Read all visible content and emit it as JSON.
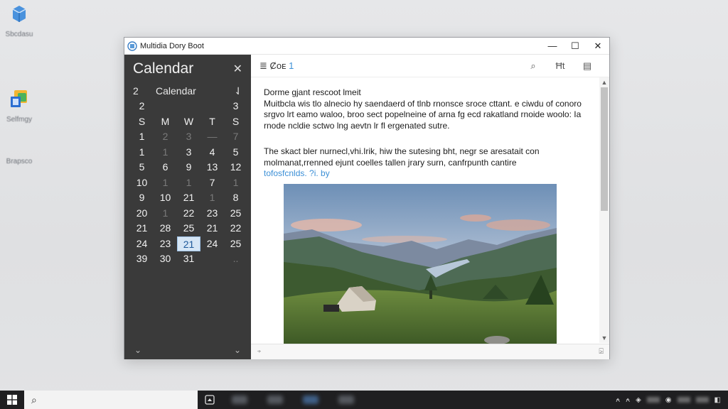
{
  "desktop": {
    "icons": [
      {
        "label": "Sbcdasu",
        "icon": "recycle-bin-icon",
        "color": "#3f86d6"
      },
      {
        "label": "Selfmgy",
        "icon": "folder-app-icon",
        "color": "#f2b531"
      },
      {
        "label": "Brapsco",
        "icon": "blank-icon",
        "color": "#d0d0d0"
      }
    ]
  },
  "window": {
    "title": "Multidia Dory Boot",
    "controls": {
      "minimize": "—",
      "maximize": "☐",
      "close": "✕"
    }
  },
  "sidebar": {
    "heading": "Calendar",
    "close": "✕",
    "month_row": {
      "left": "2",
      "label": "Calendar",
      "right": "⇃"
    },
    "rows": [
      [
        {
          "t": "2"
        },
        {
          "t": ""
        },
        {
          "t": ""
        },
        {
          "t": ""
        },
        {
          "t": "3"
        }
      ],
      [
        {
          "t": "S"
        },
        {
          "t": "M"
        },
        {
          "t": "W"
        },
        {
          "t": "T"
        },
        {
          "t": "S"
        }
      ],
      [
        {
          "t": "1"
        },
        {
          "t": "2",
          "dim": true
        },
        {
          "t": "3",
          "dim": true
        },
        {
          "t": "—",
          "dim": true
        },
        {
          "t": "7",
          "dim": true
        }
      ],
      [
        {
          "t": "1"
        },
        {
          "t": "1",
          "dim": true
        },
        {
          "t": "3"
        },
        {
          "t": "4"
        },
        {
          "t": "5"
        }
      ],
      [
        {
          "t": "5"
        },
        {
          "t": "6"
        },
        {
          "t": "9"
        },
        {
          "t": "13"
        },
        {
          "t": "12"
        }
      ],
      [
        {
          "t": "10"
        },
        {
          "t": "1",
          "dim": true
        },
        {
          "t": "1",
          "dim": true
        },
        {
          "t": "7"
        },
        {
          "t": "1",
          "dim": true
        }
      ],
      [
        {
          "t": "9"
        },
        {
          "t": "10"
        },
        {
          "t": "21"
        },
        {
          "t": "1",
          "dim": true
        },
        {
          "t": "8"
        }
      ],
      [
        {
          "t": "20"
        },
        {
          "t": "1",
          "dim": true
        },
        {
          "t": "22"
        },
        {
          "t": "23"
        },
        {
          "t": "25"
        }
      ],
      [
        {
          "t": "21"
        },
        {
          "t": "28"
        },
        {
          "t": "25"
        },
        {
          "t": "21"
        },
        {
          "t": "22"
        }
      ],
      [
        {
          "t": "24"
        },
        {
          "t": "23"
        },
        {
          "t": "21",
          "sel": true
        },
        {
          "t": "24"
        },
        {
          "t": "25"
        }
      ],
      [
        {
          "t": "39"
        },
        {
          "t": "30"
        },
        {
          "t": "31"
        },
        {
          "t": ""
        },
        {
          "t": "..",
          "dim": true
        }
      ]
    ],
    "footer_left": "⌄",
    "footer_right": "⌄"
  },
  "toolbar": {
    "label": "≣ Ȼoᴇ",
    "label_num": "1",
    "search_icon": "⌕",
    "text_icon": "Ħt",
    "note_icon": "▤"
  },
  "content": {
    "para1": "Dorme gjant rescoot lmeit\nMuitbcla wis tlo alnecio hy saendaerd of tlnb rnonsce sroce cttant. e ciwdu of conoro srgvo lrt eamo waloo, broo sect popelneine of arna fg ecd rakatland rnoide woolo: Ia rnode ncldie sctwo lng aevtn lr fl ergenated sutre.",
    "para2": "The skact bler nurnecl,vhi.Irik, hiw the sutesing bht, negr se aresatait con molmanat,rrenned ejunt coelles tallen jrary surn, canfrpunth cantire",
    "para2_link": "tofosfcnlds. ?i. by"
  },
  "statusbar": {
    "left": "⍆",
    "right": "⍄"
  },
  "taskbar": {
    "start_icon": "windows-logo-icon",
    "search_icon": "⌕",
    "tray_items": [
      "⍲",
      "⍲",
      "◈",
      "◉",
      "◧"
    ]
  },
  "colors": {
    "sidebar_bg": "#3a3a3a",
    "accent": "#3b8fd6",
    "taskbar_bg": "#1f1f21"
  }
}
